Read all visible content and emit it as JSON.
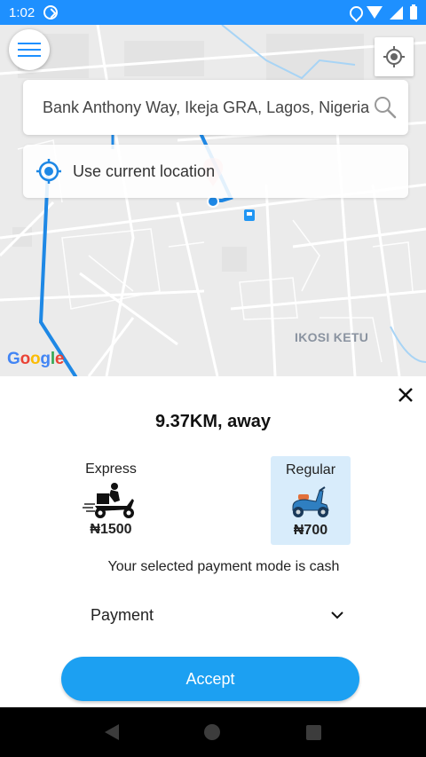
{
  "status_bar": {
    "time": "1:02",
    "icons": [
      "sync-icon",
      "location-pin-icon",
      "wifi-icon",
      "signal-icon",
      "battery-icon"
    ],
    "color": "#1e90ff"
  },
  "map": {
    "area_label": "IKOSI KETU",
    "google_logo": "Google",
    "route_color": "#1e88e5"
  },
  "search": {
    "value": "Bank Anthony Way, Ikeja GRA, Lagos, Nigeria",
    "placeholder": ""
  },
  "current_location": {
    "label": "Use current location"
  },
  "sheet": {
    "distance": "9.37KM, away",
    "options": [
      {
        "name": "Express",
        "price": "₦1500",
        "icon": "delivery-scooter-rider-icon",
        "selected": false
      },
      {
        "name": "Regular",
        "price": "₦700",
        "icon": "scooter-icon",
        "selected": true
      }
    ],
    "payment_note": "Your selected payment mode is cash",
    "payment_select": "Payment",
    "accept_label": "Accept",
    "accent_color": "#1ca0f2",
    "selected_bg": "#d8ecfb"
  },
  "nav": {
    "icons": [
      "back-icon",
      "home-icon",
      "recents-icon"
    ]
  }
}
